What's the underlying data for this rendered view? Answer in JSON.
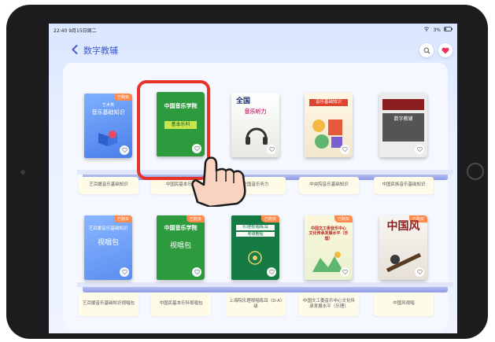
{
  "status_bar": {
    "time_date": "22:40  9月15日周二",
    "battery": "3%"
  },
  "nav": {
    "title": "数字教辅"
  },
  "books_row1": [
    {
      "id": "b1",
      "badge": "已购买",
      "cover": "音乐基础知识",
      "cover_sub": "艺术类",
      "label": "艺百媛音乐基础知识",
      "color": "#5a8ef0"
    },
    {
      "id": "b2",
      "badge": "",
      "cover": "中国音乐学院",
      "cover_sub": "基本乐科",
      "label": "中国民基本乐科",
      "color": "#2e9a3e"
    },
    {
      "id": "b3",
      "badge": "",
      "cover": "全国",
      "cover_sub": "音乐听力",
      "label": "全国音乐听力",
      "color": "#f2f2ee"
    },
    {
      "id": "b4",
      "badge": "",
      "cover": "音乐基础知识",
      "cover_sub": "",
      "label": "中央院音乐基础知识",
      "color": "#f4f0e4"
    },
    {
      "id": "b5",
      "badge": "",
      "cover": "数字教辅",
      "cover_sub": "",
      "label": "中国民族音乐基础知识",
      "color": "#e8e8e8"
    }
  ],
  "books_row2": [
    {
      "id": "b6",
      "badge": "已购买",
      "cover": "艺百媛音乐基础知识",
      "cover_sub": "视唱包",
      "label": "艺百媛音乐基础知识视唱包",
      "color": "#6b9cf0"
    },
    {
      "id": "b7",
      "badge": "已购买",
      "cover": "中国音乐学院",
      "cover_sub": "视唱包",
      "label": "中国民基本乐科视唱包",
      "color": "#2e9a3e"
    },
    {
      "id": "b8",
      "badge": "已购买",
      "cover": "乐理视唱练耳",
      "cover_sub": "考级教程",
      "label": "上海院乐理视唱练耳（D-A）级",
      "color": "#157a43"
    },
    {
      "id": "b9",
      "badge": "已购买",
      "cover": "中国文工委音乐中心 文化传承发展水平（乐理）",
      "cover_sub": "",
      "label": "中国文工委音乐中心文化传承发展水平（乐理）",
      "color": "#f6f2d6"
    },
    {
      "id": "b10",
      "badge": "已购买",
      "cover": "中国风",
      "cover_sub": "",
      "label": "中国风视唱",
      "color": "#f3f0ea"
    }
  ]
}
